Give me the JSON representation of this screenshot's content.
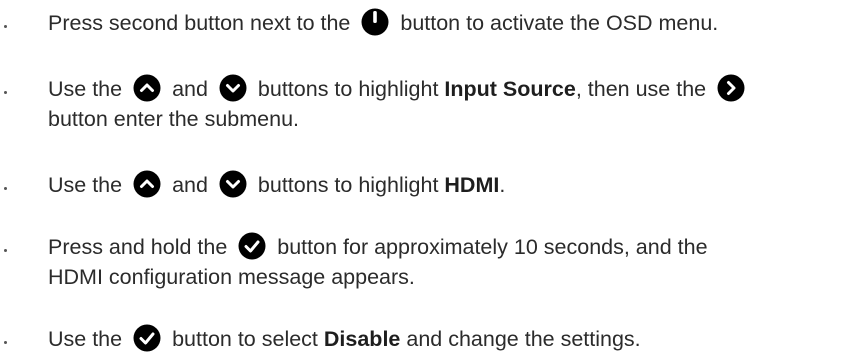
{
  "steps": [
    {
      "part1": "Press second button next to the",
      "icon1": "power-icon",
      "part2": "button to activate the OSD menu."
    },
    {
      "part1": "Use the",
      "icon1": "up-arrow-icon",
      "part2": "and",
      "icon2": "down-arrow-icon",
      "part3": "buttons to highlight",
      "bold1": "Input Source",
      "part4": ", then use the",
      "icon3": "right-arrow-icon",
      "line2": "button enter the submenu."
    },
    {
      "part1": "Use the",
      "icon1": "up-arrow-icon",
      "part2": "and",
      "icon2": "down-arrow-icon",
      "part3": "buttons to highlight",
      "bold1": "HDMI",
      "part4": "."
    },
    {
      "part1": "Press and hold the",
      "icon1": "checkmark-icon",
      "part2": "button for approximately 10 seconds, and the",
      "line2": "HDMI configuration message appears."
    },
    {
      "part1": "Use the",
      "icon1": "checkmark-icon",
      "part2": "button to select",
      "bold1": "Disable",
      "part3": "and change the settings."
    }
  ],
  "colors": {
    "text": "#2b2b2b",
    "icon_fill": "#000000",
    "icon_glyph": "#ffffff"
  }
}
